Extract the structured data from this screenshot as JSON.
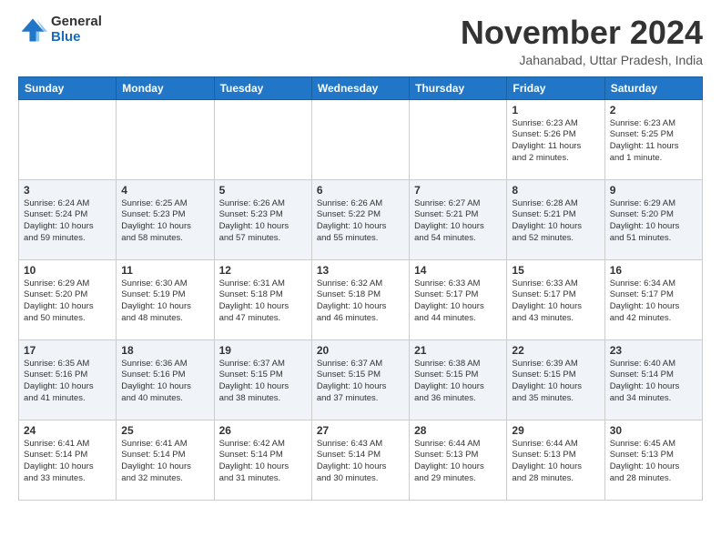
{
  "logo": {
    "general": "General",
    "blue": "Blue"
  },
  "title": "November 2024",
  "location": "Jahanabad, Uttar Pradesh, India",
  "weekdays": [
    "Sunday",
    "Monday",
    "Tuesday",
    "Wednesday",
    "Thursday",
    "Friday",
    "Saturday"
  ],
  "rows": [
    [
      {
        "day": "",
        "info": ""
      },
      {
        "day": "",
        "info": ""
      },
      {
        "day": "",
        "info": ""
      },
      {
        "day": "",
        "info": ""
      },
      {
        "day": "",
        "info": ""
      },
      {
        "day": "1",
        "info": "Sunrise: 6:23 AM\nSunset: 5:26 PM\nDaylight: 11 hours\nand 2 minutes."
      },
      {
        "day": "2",
        "info": "Sunrise: 6:23 AM\nSunset: 5:25 PM\nDaylight: 11 hours\nand 1 minute."
      }
    ],
    [
      {
        "day": "3",
        "info": "Sunrise: 6:24 AM\nSunset: 5:24 PM\nDaylight: 10 hours\nand 59 minutes."
      },
      {
        "day": "4",
        "info": "Sunrise: 6:25 AM\nSunset: 5:23 PM\nDaylight: 10 hours\nand 58 minutes."
      },
      {
        "day": "5",
        "info": "Sunrise: 6:26 AM\nSunset: 5:23 PM\nDaylight: 10 hours\nand 57 minutes."
      },
      {
        "day": "6",
        "info": "Sunrise: 6:26 AM\nSunset: 5:22 PM\nDaylight: 10 hours\nand 55 minutes."
      },
      {
        "day": "7",
        "info": "Sunrise: 6:27 AM\nSunset: 5:21 PM\nDaylight: 10 hours\nand 54 minutes."
      },
      {
        "day": "8",
        "info": "Sunrise: 6:28 AM\nSunset: 5:21 PM\nDaylight: 10 hours\nand 52 minutes."
      },
      {
        "day": "9",
        "info": "Sunrise: 6:29 AM\nSunset: 5:20 PM\nDaylight: 10 hours\nand 51 minutes."
      }
    ],
    [
      {
        "day": "10",
        "info": "Sunrise: 6:29 AM\nSunset: 5:20 PM\nDaylight: 10 hours\nand 50 minutes."
      },
      {
        "day": "11",
        "info": "Sunrise: 6:30 AM\nSunset: 5:19 PM\nDaylight: 10 hours\nand 48 minutes."
      },
      {
        "day": "12",
        "info": "Sunrise: 6:31 AM\nSunset: 5:18 PM\nDaylight: 10 hours\nand 47 minutes."
      },
      {
        "day": "13",
        "info": "Sunrise: 6:32 AM\nSunset: 5:18 PM\nDaylight: 10 hours\nand 46 minutes."
      },
      {
        "day": "14",
        "info": "Sunrise: 6:33 AM\nSunset: 5:17 PM\nDaylight: 10 hours\nand 44 minutes."
      },
      {
        "day": "15",
        "info": "Sunrise: 6:33 AM\nSunset: 5:17 PM\nDaylight: 10 hours\nand 43 minutes."
      },
      {
        "day": "16",
        "info": "Sunrise: 6:34 AM\nSunset: 5:17 PM\nDaylight: 10 hours\nand 42 minutes."
      }
    ],
    [
      {
        "day": "17",
        "info": "Sunrise: 6:35 AM\nSunset: 5:16 PM\nDaylight: 10 hours\nand 41 minutes."
      },
      {
        "day": "18",
        "info": "Sunrise: 6:36 AM\nSunset: 5:16 PM\nDaylight: 10 hours\nand 40 minutes."
      },
      {
        "day": "19",
        "info": "Sunrise: 6:37 AM\nSunset: 5:15 PM\nDaylight: 10 hours\nand 38 minutes."
      },
      {
        "day": "20",
        "info": "Sunrise: 6:37 AM\nSunset: 5:15 PM\nDaylight: 10 hours\nand 37 minutes."
      },
      {
        "day": "21",
        "info": "Sunrise: 6:38 AM\nSunset: 5:15 PM\nDaylight: 10 hours\nand 36 minutes."
      },
      {
        "day": "22",
        "info": "Sunrise: 6:39 AM\nSunset: 5:15 PM\nDaylight: 10 hours\nand 35 minutes."
      },
      {
        "day": "23",
        "info": "Sunrise: 6:40 AM\nSunset: 5:14 PM\nDaylight: 10 hours\nand 34 minutes."
      }
    ],
    [
      {
        "day": "24",
        "info": "Sunrise: 6:41 AM\nSunset: 5:14 PM\nDaylight: 10 hours\nand 33 minutes."
      },
      {
        "day": "25",
        "info": "Sunrise: 6:41 AM\nSunset: 5:14 PM\nDaylight: 10 hours\nand 32 minutes."
      },
      {
        "day": "26",
        "info": "Sunrise: 6:42 AM\nSunset: 5:14 PM\nDaylight: 10 hours\nand 31 minutes."
      },
      {
        "day": "27",
        "info": "Sunrise: 6:43 AM\nSunset: 5:14 PM\nDaylight: 10 hours\nand 30 minutes."
      },
      {
        "day": "28",
        "info": "Sunrise: 6:44 AM\nSunset: 5:13 PM\nDaylight: 10 hours\nand 29 minutes."
      },
      {
        "day": "29",
        "info": "Sunrise: 6:44 AM\nSunset: 5:13 PM\nDaylight: 10 hours\nand 28 minutes."
      },
      {
        "day": "30",
        "info": "Sunrise: 6:45 AM\nSunset: 5:13 PM\nDaylight: 10 hours\nand 28 minutes."
      }
    ]
  ]
}
